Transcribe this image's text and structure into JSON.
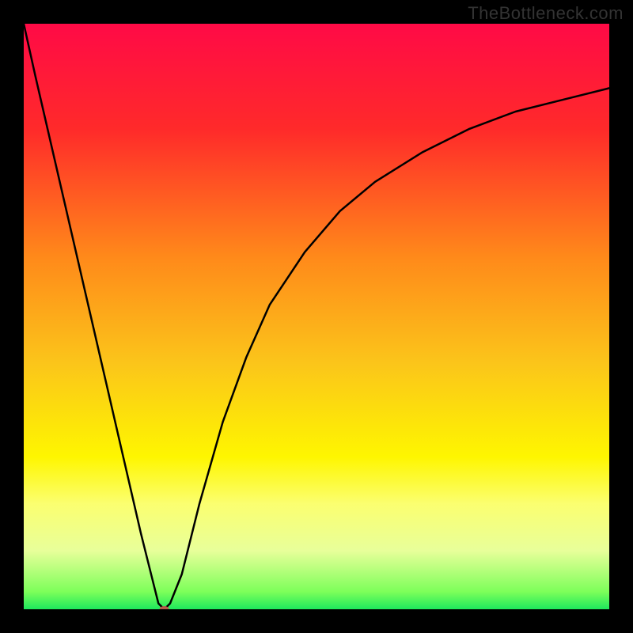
{
  "watermark": "TheBottleneck.com",
  "chart_data": {
    "type": "line",
    "title": "",
    "xlabel": "",
    "ylabel": "",
    "xlim": [
      0,
      100
    ],
    "ylim": [
      0,
      100
    ],
    "gradient_stops": [
      {
        "offset": 0,
        "color": "#ff0a46"
      },
      {
        "offset": 18,
        "color": "#ff2a2a"
      },
      {
        "offset": 40,
        "color": "#ff8a1a"
      },
      {
        "offset": 58,
        "color": "#fbc51a"
      },
      {
        "offset": 74,
        "color": "#fef600"
      },
      {
        "offset": 82,
        "color": "#fbff70"
      },
      {
        "offset": 90,
        "color": "#e8ff9a"
      },
      {
        "offset": 97,
        "color": "#7dff5a"
      },
      {
        "offset": 100,
        "color": "#1ee85c"
      }
    ],
    "x": [
      0,
      2,
      5,
      8,
      11,
      14,
      17,
      20,
      22,
      23,
      24,
      25,
      27,
      30,
      34,
      38,
      42,
      48,
      54,
      60,
      68,
      76,
      84,
      92,
      100
    ],
    "y": [
      100,
      91,
      78,
      65,
      52,
      39,
      26,
      13,
      5,
      1,
      0,
      1,
      6,
      18,
      32,
      43,
      52,
      61,
      68,
      73,
      78,
      82,
      85,
      87,
      89
    ],
    "vertex_marker": {
      "x": 24,
      "y": 0,
      "rx": 6,
      "ry": 4,
      "color": "#b35a4a"
    }
  }
}
